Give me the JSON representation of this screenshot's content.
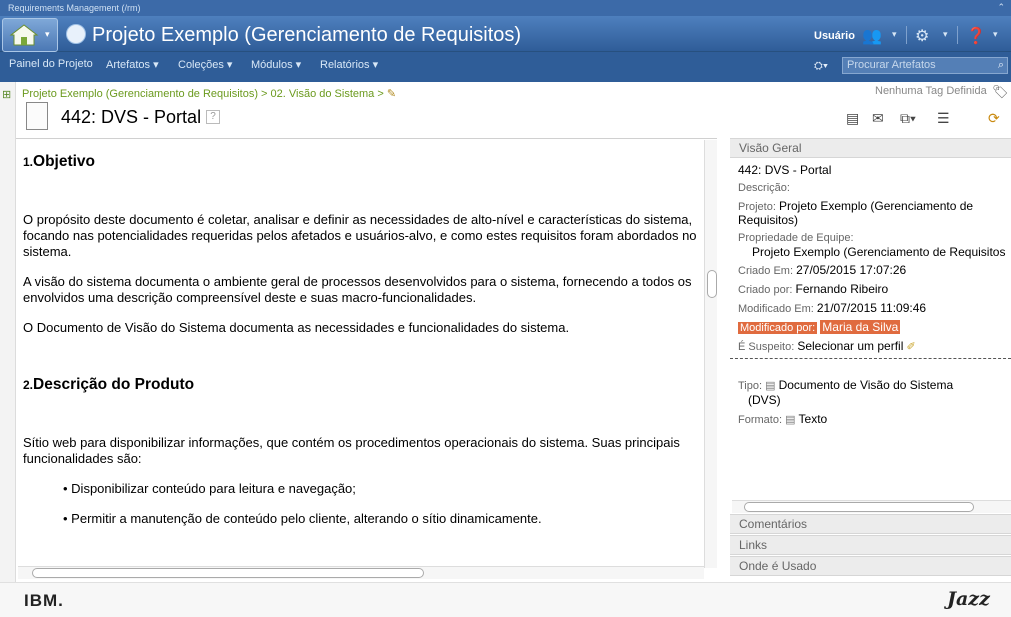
{
  "header": {
    "app_title": "Requirements Management (/rm)",
    "project_title": "Projeto Exemplo (Gerenciamento de Requisitos)",
    "user_label": "Usuário"
  },
  "nav": {
    "items": [
      "Painel do Projeto",
      "Artefatos ▾",
      "Coleções ▾",
      "Módulos ▾",
      "Relatórios ▾"
    ],
    "search_placeholder": "Procurar Artefatos"
  },
  "artifact": {
    "breadcrumb": "Projeto Exemplo (Gerenciamento de Requisitos) > 02. Visão do Sistema >",
    "tag_label": "Nenhuma Tag Definida",
    "title": "442: DVS - Portal"
  },
  "document": {
    "h1_num": "1.",
    "h1": "Objetivo",
    "p1": "O propósito deste documento é coletar, analisar e definir as necessidades de alto-nível e características do sistema, focando nas potencialidades requeridas pelos afetados e usuários-alvo, e como estes requisitos foram abordados no sistema.",
    "p2": "A visão do sistema documenta o ambiente geral de processos desenvolvidos para o sistema, fornecendo a todos os envolvidos uma descrição compreensível deste e suas macro-funcionalidades.",
    "p3": "O Documento de Visão do Sistema documenta as necessidades e funcionalidades do sistema.",
    "h2_num": "2.",
    "h2": "Descrição do Produto",
    "p4": "Sítio web para disponibilizar informações, que contém os procedimentos operacionais do sistema. Suas principais funcionalidades são:",
    "b1": "• Disponibilizar conteúdo para leitura e navegação;",
    "b2": "• Permitir a manutenção de conteúdo pelo cliente, alterando o sítio dinamicamente."
  },
  "overview": {
    "header": "Visão Geral",
    "id_title": "442: DVS - Portal",
    "desc_label": "Descrição:",
    "project_label": "Projeto:",
    "project_value": "Projeto Exemplo (Gerenciamento de Requisitos)",
    "team_label": "Propriedade de Equipe:",
    "team_value": "Projeto Exemplo (Gerenciamento de Requisitos",
    "created_label": "Criado Em:",
    "created_value": "27/05/2015 17:07:26",
    "creator_label": "Criado por:",
    "creator_value": "Fernando Ribeiro",
    "modified_label": "Modificado Em:",
    "modified_value": "21/07/2015 11:09:46",
    "modifier_label": "Modificado por:",
    "modifier_value": "Maria da Silva",
    "suspect_label": "É Suspeito:",
    "suspect_value": "Selecionar um perfil",
    "type_label": "Tipo:",
    "type_value": "Documento de Visão do Sistema",
    "type_value2": "(DVS)",
    "format_label": "Formato:",
    "format_value": "Texto"
  },
  "sections": {
    "comments": "Comentários",
    "links": "Links",
    "where_used": "Onde é Usado"
  },
  "footer": {
    "ibm": "IBM.",
    "jazz": "Jazz"
  },
  "colors": {
    "banner": "#3c6aa8",
    "breadcrumb": "#6b9a1e",
    "highlight": "#e06b3f"
  }
}
